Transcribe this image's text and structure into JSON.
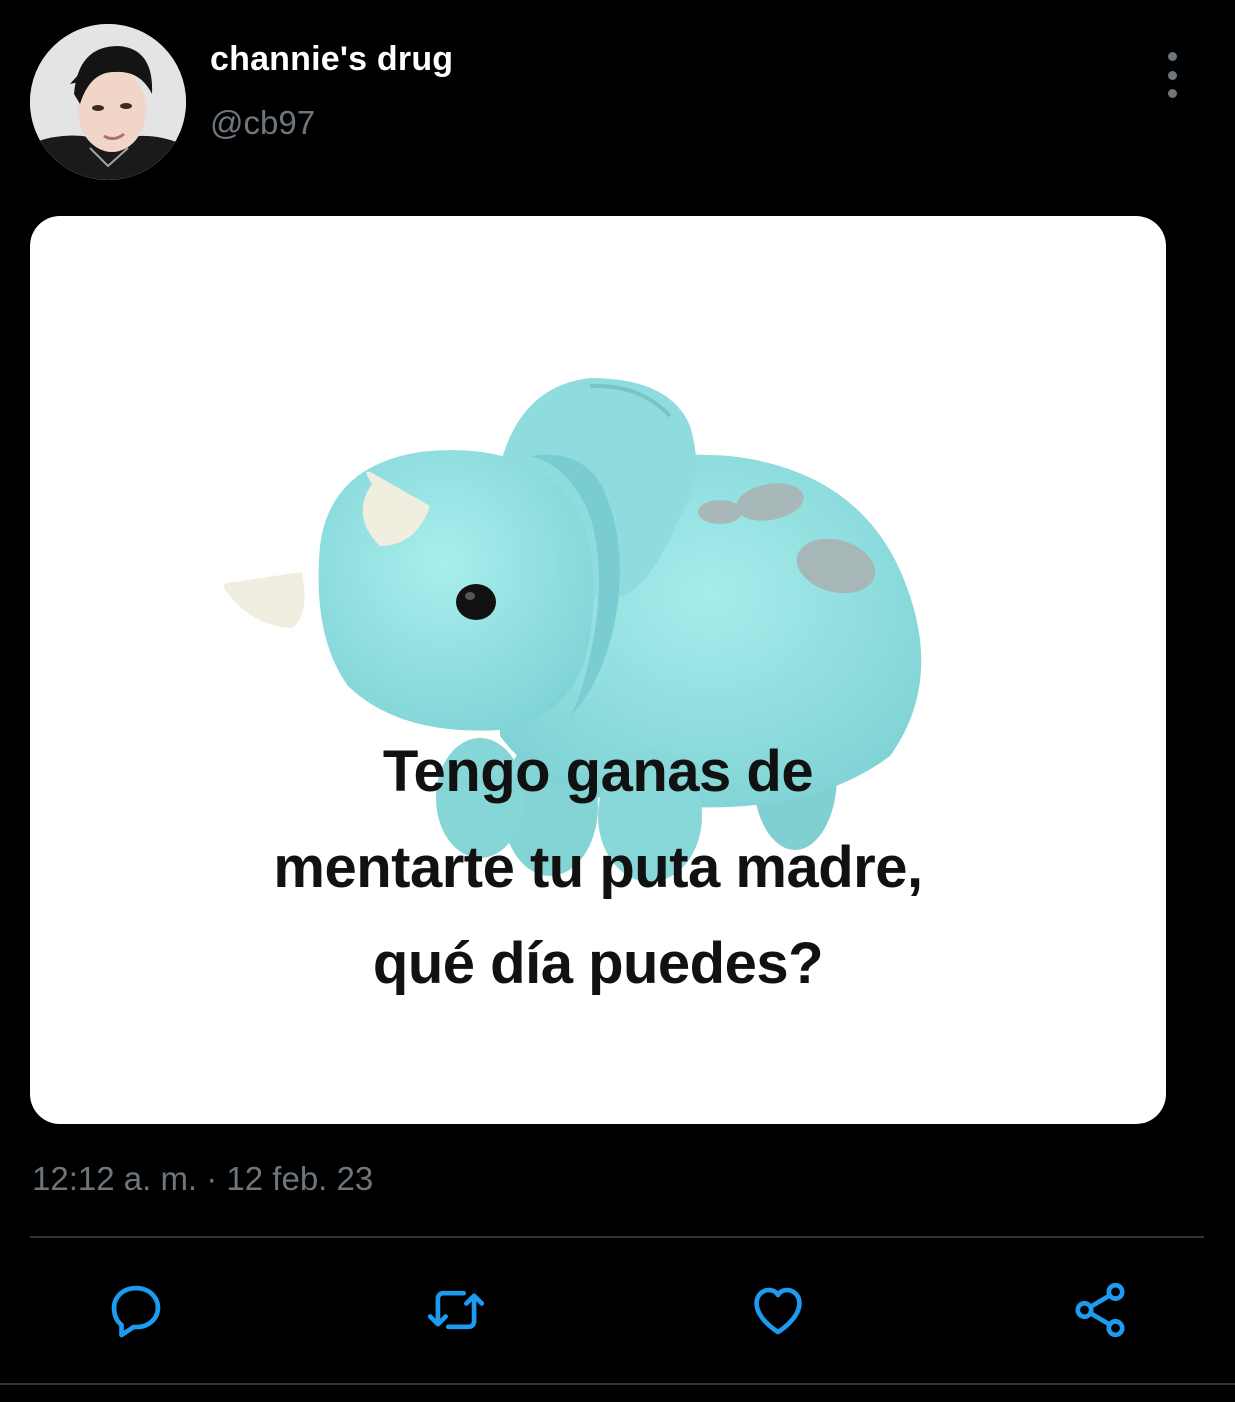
{
  "tweet": {
    "author": {
      "display_name": "channie's drug",
      "handle": "@cb97",
      "avatar_icon": "profile-photo"
    },
    "more_icon": "more-vertical-icon",
    "media": {
      "caption_lines": [
        "Tengo ganas de",
        "mentarte tu puta madre,",
        "qué día puedes?"
      ]
    },
    "timestamp": "12:12 a. m. · 12 feb. 23",
    "actions": [
      {
        "icon": "reply-icon"
      },
      {
        "icon": "retweet-icon"
      },
      {
        "icon": "like-icon"
      },
      {
        "icon": "share-icon"
      }
    ]
  },
  "colors": {
    "background": "#000000",
    "text_primary": "#ffffff",
    "text_secondary": "#6e767d",
    "divider": "#2f3336",
    "accent_action": "#1d9bf0",
    "plush": "#93e0e0"
  }
}
